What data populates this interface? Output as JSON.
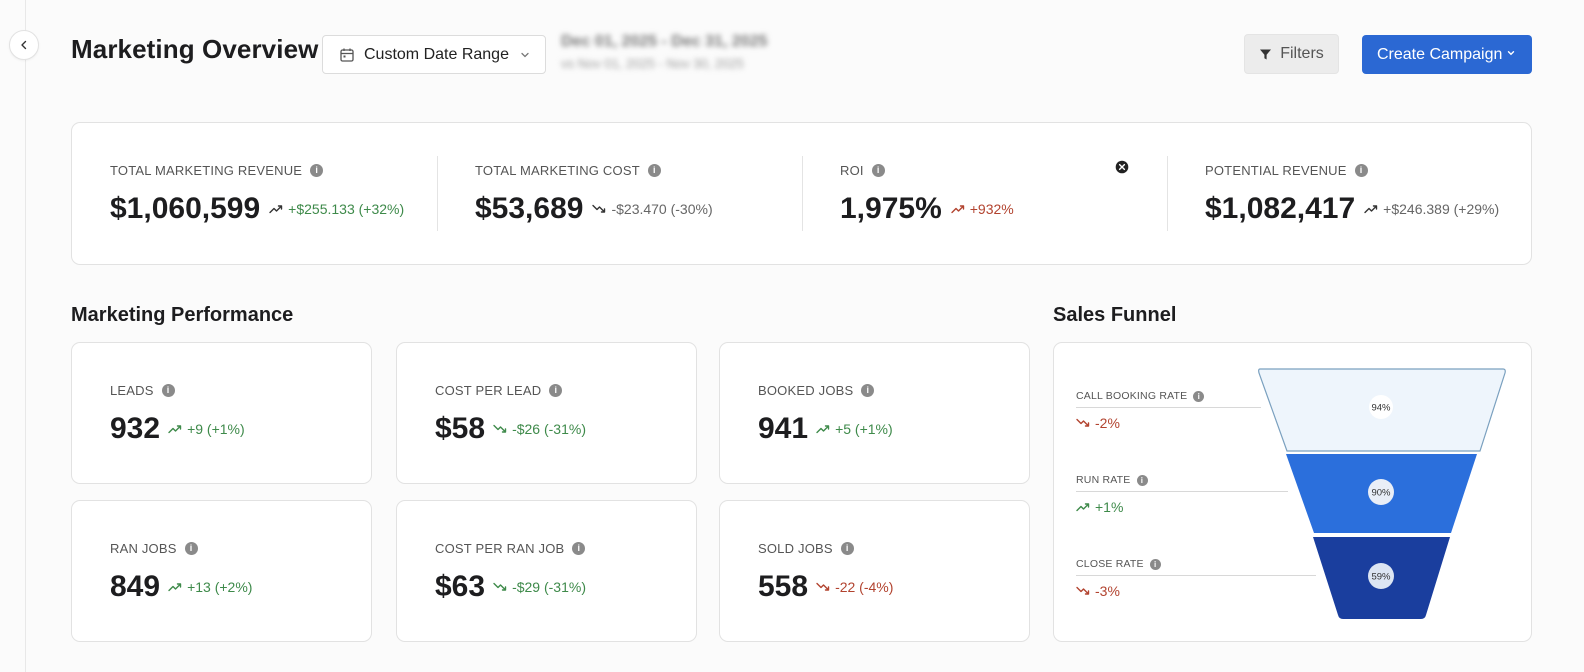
{
  "header": {
    "title": "Marketing Overview",
    "date_range_label": "Custom Date Range",
    "date_range_primary": "Dec 01, 2025 - Dec 31, 2025",
    "date_range_compare": "vs Nov 01, 2025 - Nov 30, 2025",
    "filters_label": "Filters",
    "create_label": "Create Campaign"
  },
  "kpis": [
    {
      "label": "TOTAL MARKETING REVENUE",
      "value": "$1,060,599",
      "delta": "+$255.133 (+32%)",
      "trend": "up"
    },
    {
      "label": "TOTAL MARKETING COST",
      "value": "$53,689",
      "delta": "-$23.470 (-30%)",
      "trend": "down"
    },
    {
      "label": "ROI",
      "value": "1,975%",
      "delta": "+932%",
      "trend": "up"
    },
    {
      "label": "POTENTIAL REVENUE",
      "value": "$1,082,417",
      "delta": "+$246.389 (+29%)",
      "trend": "up"
    }
  ],
  "performance": {
    "title": "Marketing Performance",
    "cards": [
      {
        "label": "LEADS",
        "value": "932",
        "delta": "+9 (+1%)",
        "trend": "up"
      },
      {
        "label": "COST PER LEAD",
        "value": "$58",
        "delta": "-$26 (-31%)",
        "trend": "down"
      },
      {
        "label": "BOOKED JOBS",
        "value": "941",
        "delta": "+5 (+1%)",
        "trend": "up"
      },
      {
        "label": "RAN JOBS",
        "value": "849",
        "delta": "+13 (+2%)",
        "trend": "up"
      },
      {
        "label": "COST PER RAN JOB",
        "value": "$63",
        "delta": "-$29 (-31%)",
        "trend": "down"
      },
      {
        "label": "SOLD JOBS",
        "value": "558",
        "delta": "-22 (-4%)",
        "trend": "down"
      }
    ]
  },
  "funnel": {
    "title": "Sales Funnel",
    "stages": [
      {
        "label": "CALL BOOKING RATE",
        "delta": "-2%",
        "trend": "down",
        "pct": "94%"
      },
      {
        "label": "RUN RATE",
        "delta": "+1%",
        "trend": "up",
        "pct": "90%"
      },
      {
        "label": "CLOSE RATE",
        "delta": "-3%",
        "trend": "down",
        "pct": "59%"
      }
    ]
  },
  "colors": {
    "accent": "#2b68d3",
    "positive": "#3e8a4a",
    "negative": "#b2432f",
    "funnel_top": "#eef5fc",
    "funnel_mid": "#2b6fdc",
    "funnel_bottom": "#1a3e9e"
  },
  "icons": [
    "chevron-left-icon",
    "calendar-icon",
    "chevron-down-icon",
    "filter-icon",
    "info-icon",
    "trend-up-icon",
    "trend-down-icon",
    "close-circle-icon"
  ]
}
